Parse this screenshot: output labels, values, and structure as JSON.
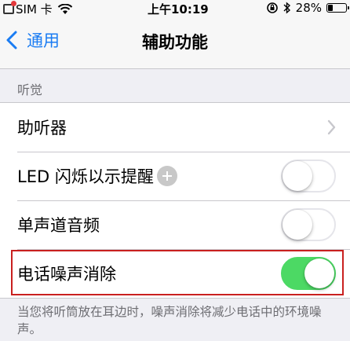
{
  "status_bar": {
    "carrier": "SIM 卡",
    "time": "上午10:19",
    "battery_percent": "28%",
    "battery_level": 0.28,
    "icons": [
      "carrier-badge-icon",
      "wifi-icon",
      "orientation-lock-icon",
      "bluetooth-icon",
      "battery-icon"
    ]
  },
  "nav": {
    "back_label": "通用",
    "title": "辅助功能"
  },
  "section": {
    "header": "听觉",
    "rows": [
      {
        "label": "助听器",
        "accessory": "chevron-right-icon"
      },
      {
        "label": "LED 闪烁以示提醒",
        "toggle_on": false,
        "extra_icon": "assistive-touch-icon"
      },
      {
        "label": "单声道音频",
        "toggle_on": false
      },
      {
        "label": "电话噪声消除",
        "toggle_on": true
      }
    ],
    "footer": "当您将听筒放在耳边时，噪声消除将减少电话中的环境噪声。"
  },
  "colors": {
    "accent": "#1a7cf3",
    "toggle_on": "#4cd964",
    "highlight": "#c9201f",
    "background": "#efeff4"
  }
}
